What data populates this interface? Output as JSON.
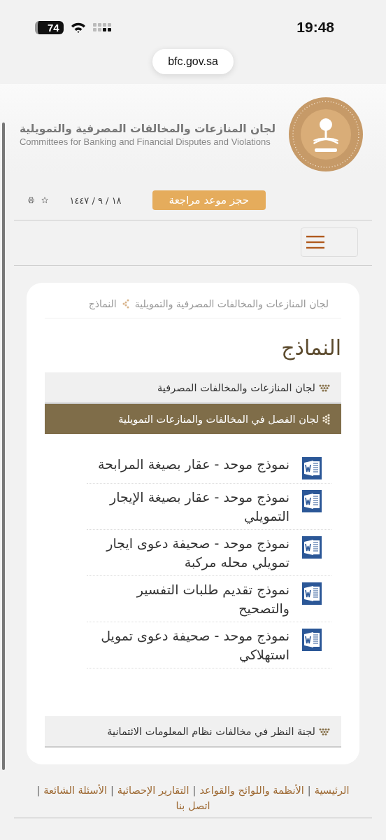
{
  "status_bar": {
    "battery": "74",
    "time": "19:48"
  },
  "address_bar": {
    "url": "bfc.gov.sa"
  },
  "header": {
    "title_ar": "لجان المنازعات والمخالفات المصرفية والتمويلية",
    "title_en": "Committees for Banking and Financial Disputes and Violations"
  },
  "toolbar": {
    "button": "حجز موعد مراجعة",
    "date": "١٨ / ٩ / ١٤٤٧"
  },
  "breadcrumb": {
    "items": [
      "لجان المنازعات والمخالفات المصرفية والتمويلية",
      "النماذج"
    ]
  },
  "page_title": "النماذج",
  "sections": [
    {
      "title": "لجان المنازعات والمخالفات المصرفية",
      "expanded": false
    },
    {
      "title": "لجان الفصل في المخالفات والمنازعات التمويلية",
      "expanded": true,
      "files": [
        "نموذج موحد - عقار بصيغة المرابحة",
        "نموذج موحد - عقار بصيغة الإيجار التمويلي",
        "نموذج موحد - صحيفة دعوى ايجار تمويلي محله مركبة",
        "نموذج تقديم طلبات التفسير والتصحيح",
        "نموذج موحد - صحيفة دعوى تمويل استهلاكي"
      ]
    },
    {
      "title": "لجنة النظر في مخالفات نظام المعلومات الائتمانية",
      "expanded": false
    }
  ],
  "footer": {
    "separator": "|",
    "links": [
      "الرئيسية",
      "الأنظمة واللوائح والقواعد",
      "التقارير الإحصائية",
      "الأسئلة الشائعة",
      "اتصل بنا"
    ]
  }
}
